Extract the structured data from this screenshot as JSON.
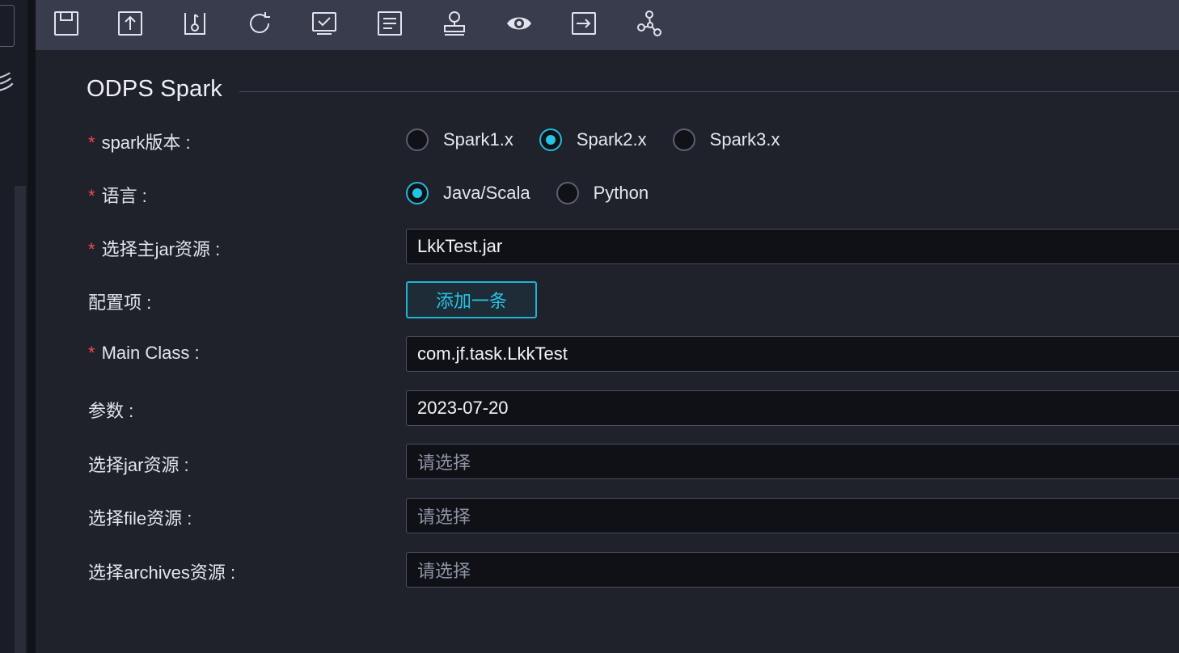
{
  "sidebar": {
    "glyph": "彡"
  },
  "toolbar": {
    "buttons": [
      {
        "name": "save-icon"
      },
      {
        "name": "upload-icon"
      },
      {
        "name": "submit-icon"
      },
      {
        "name": "refresh-icon"
      },
      {
        "name": "check-icon"
      },
      {
        "name": "log-icon"
      },
      {
        "name": "stamp-icon"
      },
      {
        "name": "view-icon"
      },
      {
        "name": "export-icon"
      },
      {
        "name": "network-icon"
      }
    ]
  },
  "section": {
    "title": "ODPS Spark"
  },
  "form": {
    "spark_version": {
      "label": "spark版本 :",
      "options": [
        "Spark1.x",
        "Spark2.x",
        "Spark3.x"
      ],
      "selected": "Spark2.x"
    },
    "language": {
      "label": "语言 :",
      "options": [
        "Java/Scala",
        "Python"
      ],
      "selected": "Java/Scala"
    },
    "main_jar": {
      "label": "选择主jar资源 :",
      "value": "LkkTest.jar"
    },
    "config": {
      "label": "配置项 :",
      "button": "添加一条"
    },
    "main_class": {
      "label": "Main Class :",
      "value": "com.jf.task.LkkTest"
    },
    "params": {
      "label": "参数 :",
      "value": "2023-07-20"
    },
    "jar_resource": {
      "label": "选择jar资源 :",
      "placeholder": "请选择"
    },
    "file_resource": {
      "label": "选择file资源 :",
      "placeholder": "请选择"
    },
    "archives_resource": {
      "label": "选择archives资源 :",
      "placeholder": "请选择"
    }
  },
  "colors": {
    "accent": "#23c4e4",
    "required": "#f04b4b",
    "toolbar": "#393c4d"
  }
}
